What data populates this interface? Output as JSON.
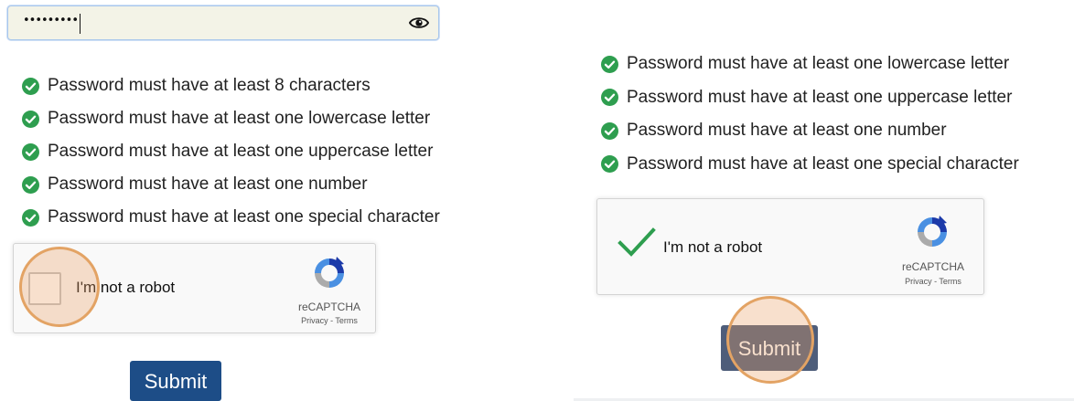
{
  "left": {
    "password": {
      "masked_value": "•••••••••"
    },
    "requirements": [
      "Password must have at least 8 characters",
      "Password must have at least one lowercase letter",
      "Password must have at least one uppercase letter",
      "Password must have at least one number",
      "Password must have at least one special character"
    ],
    "captcha": {
      "label": "I'm not a robot",
      "brand": "reCAPTCHA",
      "links": "Privacy - Terms",
      "checked": false
    },
    "submit_label": "Submit"
  },
  "right": {
    "requirements": [
      "Password must have at least one lowercase letter",
      "Password must have at least one uppercase letter",
      "Password must have at least one number",
      "Password must have at least one special character"
    ],
    "captcha": {
      "label": "I'm not a robot",
      "brand": "reCAPTCHA",
      "links": "Privacy - Terms",
      "checked": true
    },
    "submit_label": "Submit"
  },
  "icons": {
    "requirement_status": "check-circle-icon",
    "password_toggle": "eye-icon",
    "captcha_logo": "recaptcha-logo-icon"
  },
  "colors": {
    "check_green": "#2e9e4f",
    "submit_blue": "#1d4d87",
    "tap_highlight": "#e3a364",
    "field_background": "#f3f3e7"
  }
}
